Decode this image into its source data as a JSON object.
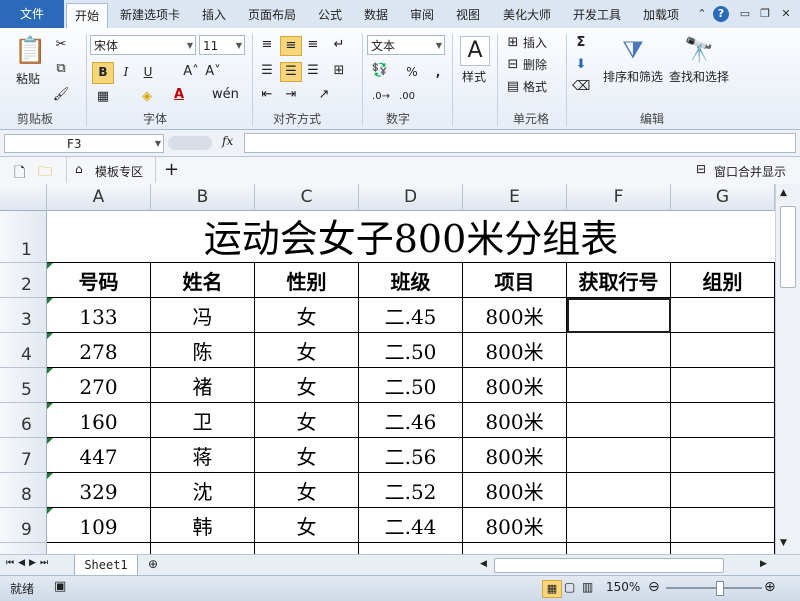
{
  "tabs": [
    "文件",
    "开始",
    "新建选项卡",
    "插入",
    "页面布局",
    "公式",
    "数据",
    "审阅",
    "视图",
    "美化大师",
    "开发工具",
    "加载项"
  ],
  "ribbon": {
    "clipboard": {
      "paste": "粘贴",
      "label": "剪贴板"
    },
    "font": {
      "name": "宋体",
      "size": "11",
      "bold": "B",
      "italic": "I",
      "underline": "U",
      "label": "字体"
    },
    "alignment": {
      "label": "对齐方式"
    },
    "number": {
      "format": "文本",
      "percent": "%",
      "comma": ",",
      "label": "数字"
    },
    "styles": {
      "label": "样式"
    },
    "cells": {
      "insert": "插入",
      "delete": "删除",
      "format": "格式",
      "label": "单元格"
    },
    "editing": {
      "sort": "排序和筛选",
      "find": "查找和选择",
      "label": "编辑"
    }
  },
  "formula_bar": {
    "name_box": "F3",
    "fx": "fx",
    "value": ""
  },
  "quick_bar": {
    "template": "模板专区",
    "merge": "窗口合并显示"
  },
  "sheet": {
    "columns": [
      "A",
      "B",
      "C",
      "D",
      "E",
      "F",
      "G"
    ],
    "title": "运动会女子800米分组表",
    "headers": [
      "号码",
      "姓名",
      "性别",
      "班级",
      "项目",
      "获取行号",
      "组别"
    ],
    "row_numbers": [
      "1",
      "2",
      "3",
      "4",
      "5",
      "6",
      "7",
      "8",
      "9"
    ],
    "rows": [
      [
        "133",
        "冯",
        "女",
        "二.45",
        "800米",
        "",
        ""
      ],
      [
        "278",
        "陈",
        "女",
        "二.50",
        "800米",
        "",
        ""
      ],
      [
        "270",
        "褚",
        "女",
        "二.50",
        "800米",
        "",
        ""
      ],
      [
        "160",
        "卫",
        "女",
        "二.46",
        "800米",
        "",
        ""
      ],
      [
        "447",
        "蒋",
        "女",
        "二.56",
        "800米",
        "",
        ""
      ],
      [
        "329",
        "沈",
        "女",
        "二.52",
        "800米",
        "",
        ""
      ],
      [
        "109",
        "韩",
        "女",
        "二.44",
        "800米",
        "",
        ""
      ]
    ]
  },
  "sheet_tab": "Sheet1",
  "status": {
    "ready": "就绪",
    "zoom": "150%"
  }
}
